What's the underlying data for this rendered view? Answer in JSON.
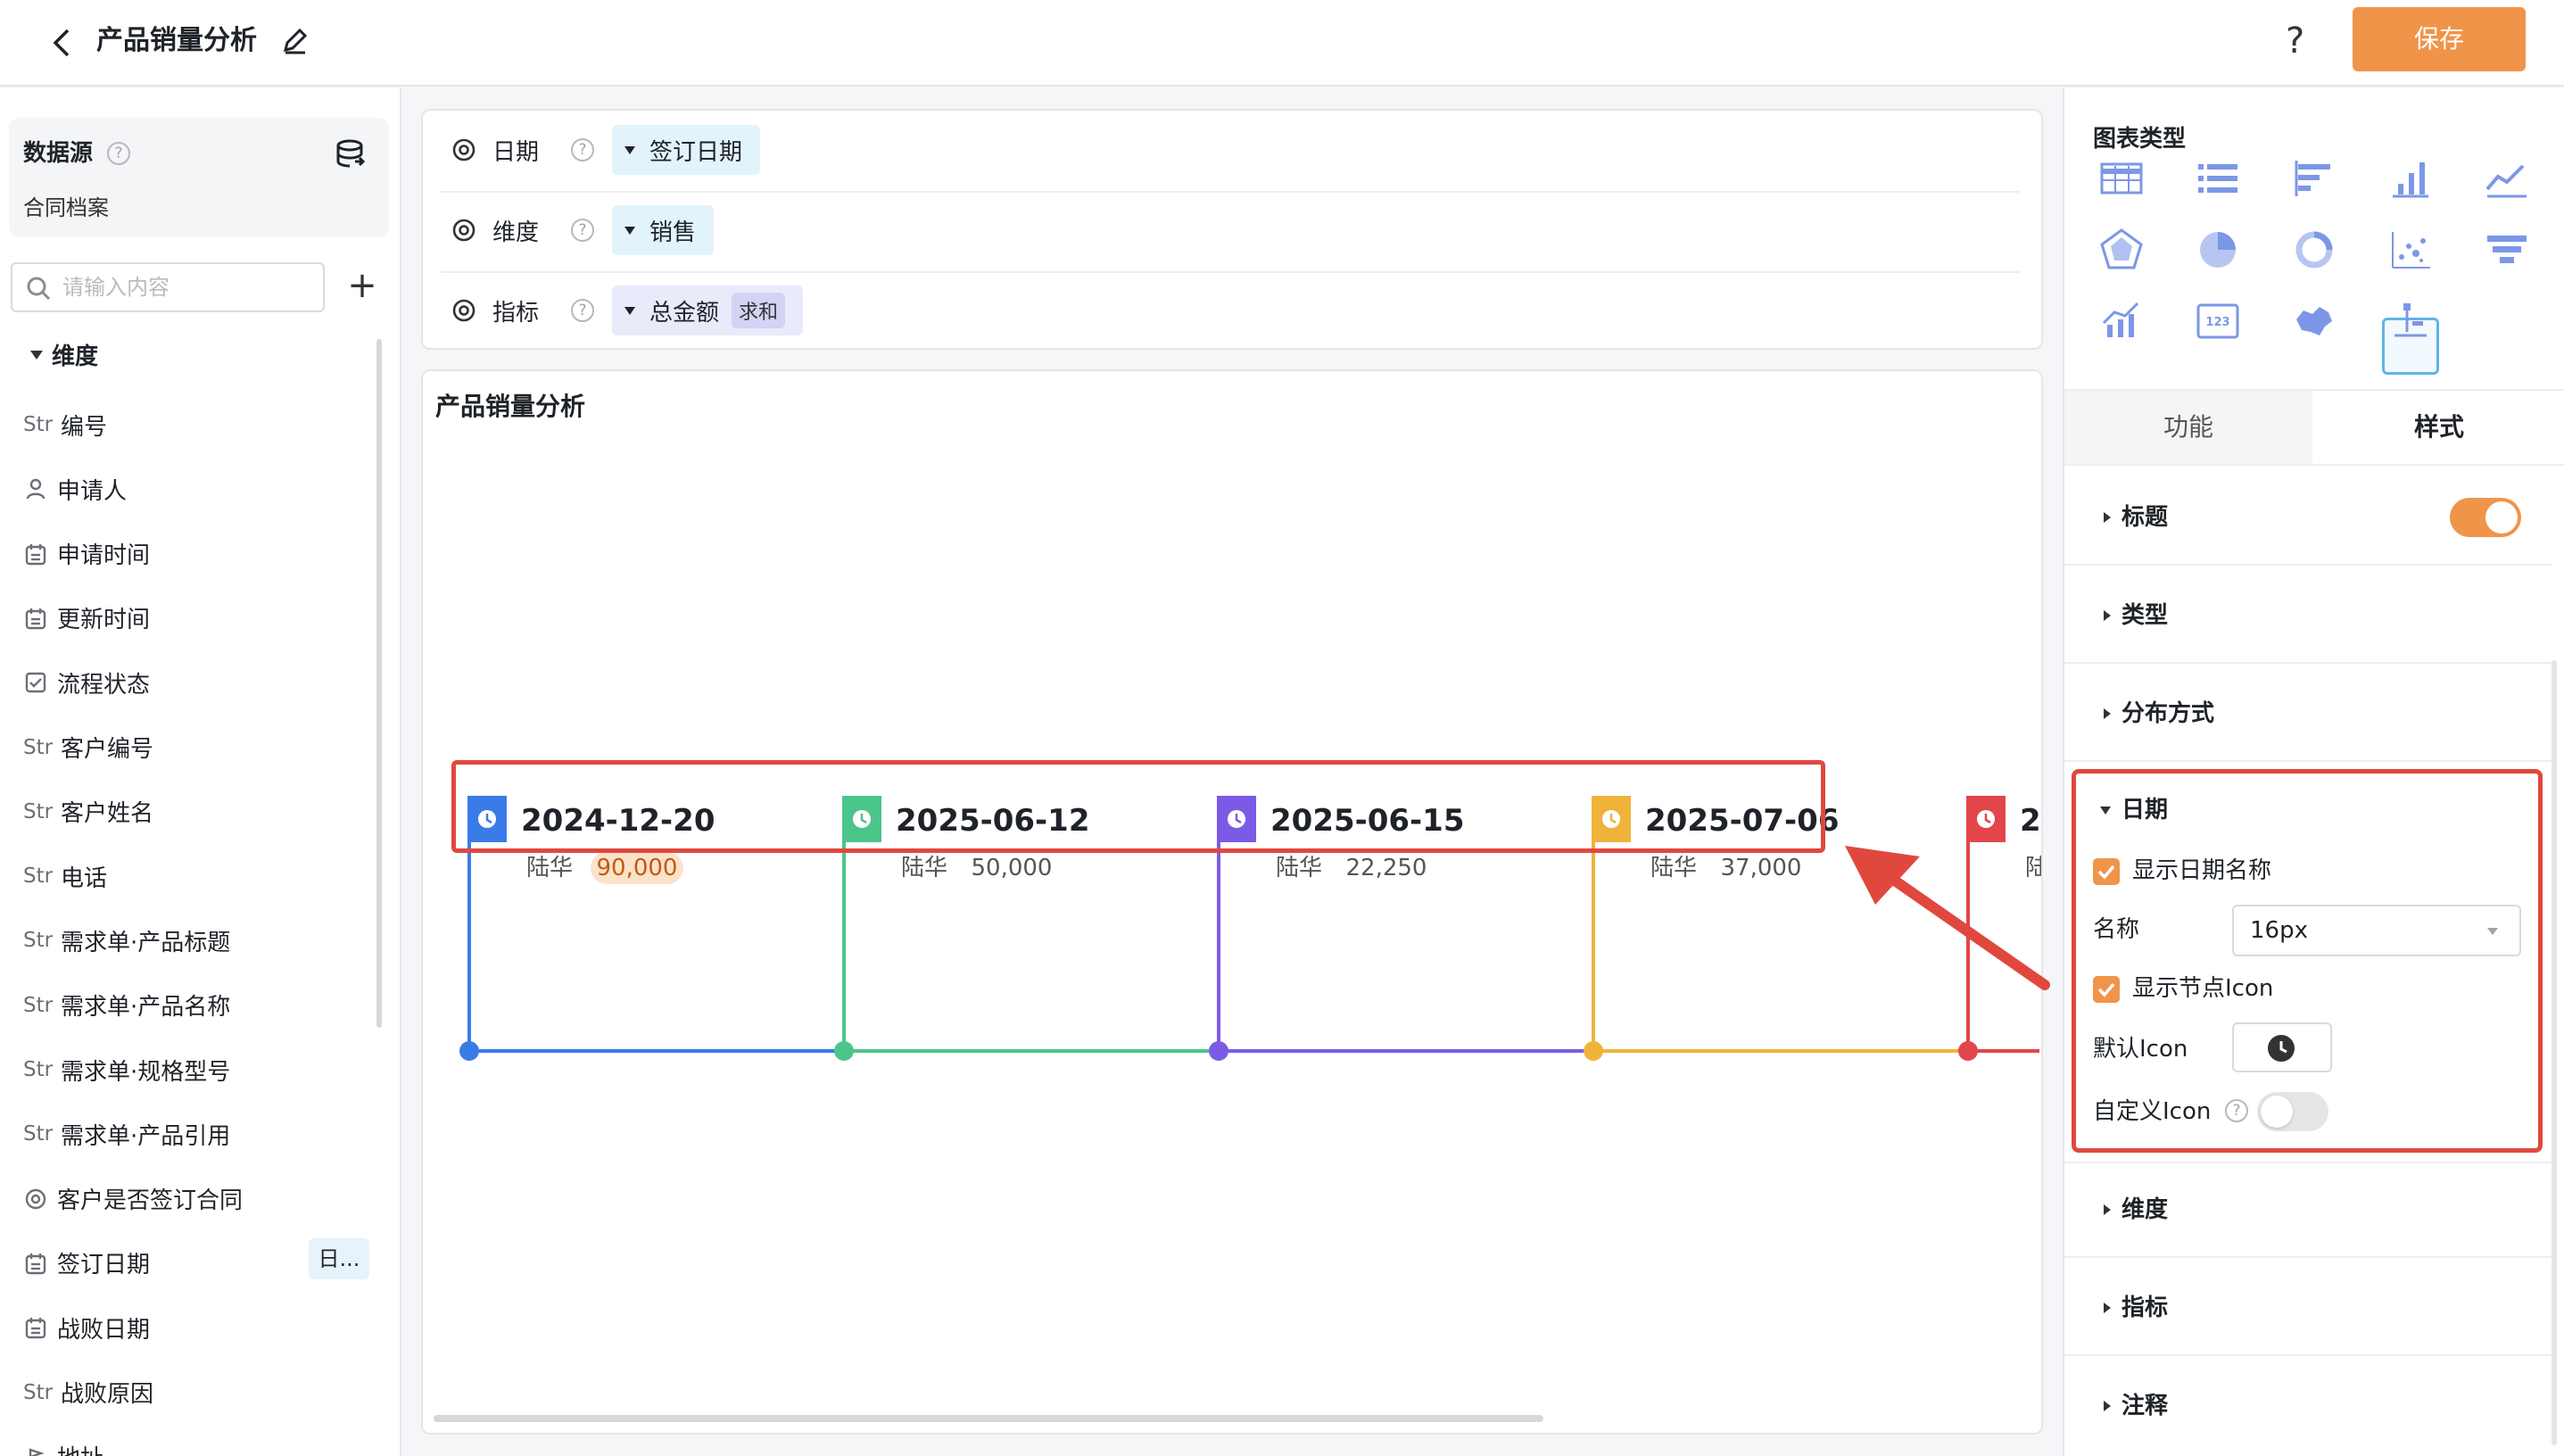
{
  "header": {
    "title": "产品销量分析",
    "help_label": "?",
    "save_label": "保存"
  },
  "datasource": {
    "label": "数据源",
    "help": "?",
    "name": "合同档案"
  },
  "search": {
    "placeholder": "请输入内容",
    "add_label": "+"
  },
  "fields": {
    "section_label": "维度",
    "items": [
      {
        "type": "Str",
        "label": "编号"
      },
      {
        "type": "user",
        "label": "申请人"
      },
      {
        "type": "date",
        "label": "申请时间"
      },
      {
        "type": "date",
        "label": "更新时间"
      },
      {
        "type": "check",
        "label": "流程状态"
      },
      {
        "type": "Str",
        "label": "客户编号"
      },
      {
        "type": "Str",
        "label": "客户姓名"
      },
      {
        "type": "Str",
        "label": "电话"
      },
      {
        "type": "Str",
        "label": "需求单·产品标题"
      },
      {
        "type": "Str",
        "label": "需求单·产品名称"
      },
      {
        "type": "Str",
        "label": "需求单·规格型号"
      },
      {
        "type": "Str",
        "label": "需求单·产品引用"
      },
      {
        "type": "radio",
        "label": "客户是否签订合同"
      },
      {
        "type": "date",
        "label": "签订日期"
      },
      {
        "type": "date",
        "label": "战败日期"
      },
      {
        "type": "Str",
        "label": "战败原因"
      },
      {
        "type": "location",
        "label": "地址"
      }
    ],
    "sign_date_tag": "日..."
  },
  "config": {
    "rows": [
      {
        "label": "日期",
        "help": "?",
        "value": "签订日期",
        "agg": ""
      },
      {
        "label": "维度",
        "help": "?",
        "value": "销售",
        "agg": ""
      },
      {
        "label": "指标",
        "help": "?",
        "value": "总金额",
        "agg": "求和"
      }
    ]
  },
  "chart": {
    "title": "产品销量分析"
  },
  "chart_data": {
    "type": "timeline",
    "events": [
      {
        "date": "2024-12-20",
        "dimension": "陆华",
        "value": "90,000",
        "color": "#3b7be8",
        "highlight": true
      },
      {
        "date": "2025-06-12",
        "dimension": "陆华",
        "value": "50,000",
        "color": "#4cc58a",
        "highlight": false
      },
      {
        "date": "2025-06-15",
        "dimension": "陆华",
        "value": "22,250",
        "color": "#7b5be6",
        "highlight": false
      },
      {
        "date": "2025-07-06",
        "dimension": "陆华",
        "value": "37,000",
        "color": "#f0b33a",
        "highlight": false
      },
      {
        "date": "2",
        "dimension": "陆",
        "value": "",
        "color": "#e2464a",
        "highlight": false
      }
    ]
  },
  "right_panel": {
    "chart_type_title": "图表类型",
    "chart_types": [
      "table-icon",
      "list-icon",
      "bar-horizontal-icon",
      "bar-vertical-icon",
      "line-icon",
      "radar-icon",
      "pie-icon",
      "donut-icon",
      "scatter-icon",
      "funnel-icon",
      "combo-icon",
      "number-card-icon",
      "map-icon",
      "timeline-icon"
    ],
    "selected_chart_type": "timeline-icon",
    "tabs": [
      "功能",
      "样式"
    ],
    "active_tab": "样式",
    "sections": {
      "title": "标题",
      "type": "类型",
      "distribution": "分布方式",
      "date": "日期",
      "dimension": "维度",
      "metric": "指标",
      "annotation": "注释"
    },
    "title_toggle_on": true,
    "date_options": {
      "show_date_name": "显示日期名称",
      "name_label": "名称",
      "name_value": "16px",
      "show_node_icon": "显示节点Icon",
      "default_icon_label": "默认Icon",
      "custom_icon_label": "自定义Icon",
      "custom_icon_help": "?",
      "custom_icon_on": false
    }
  },
  "colors": {
    "accent": "#f0944a",
    "highlight_red": "#e0483e",
    "selected_blue": "#5fb6e8"
  }
}
